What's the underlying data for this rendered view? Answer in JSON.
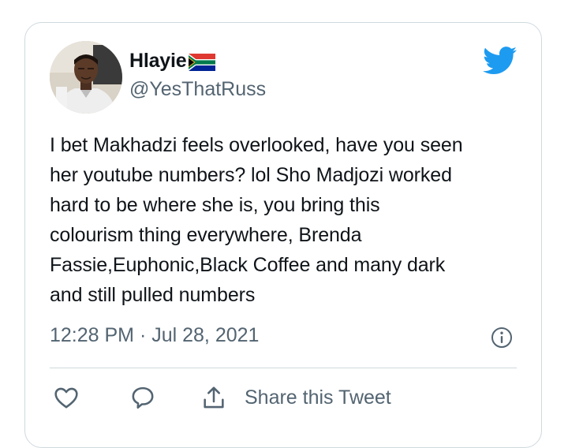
{
  "tweet": {
    "display_name": "Hlayie",
    "flag_icon": "south-africa-flag-icon",
    "handle": "@YesThatRuss",
    "text": "I bet Makhadzi feels overlooked, have you seen\nher youtube numbers? lol Sho Madjozi worked\nhard to be where she is, you bring this\ncolourism thing everywhere, Brenda\nFassie,Euphonic,Black Coffee and many dark\nand still pulled numbers",
    "timestamp": "12:28 PM · Jul 28, 2021"
  },
  "actions": {
    "like_icon": "heart-icon",
    "reply_icon": "reply-bubble-icon",
    "share_icon": "share-icon",
    "share_label": "Share this Tweet"
  },
  "colors": {
    "twitter_blue": "#1d9bf0",
    "text_primary": "#0f1419",
    "text_secondary": "#536471",
    "border": "#cfd9de"
  }
}
